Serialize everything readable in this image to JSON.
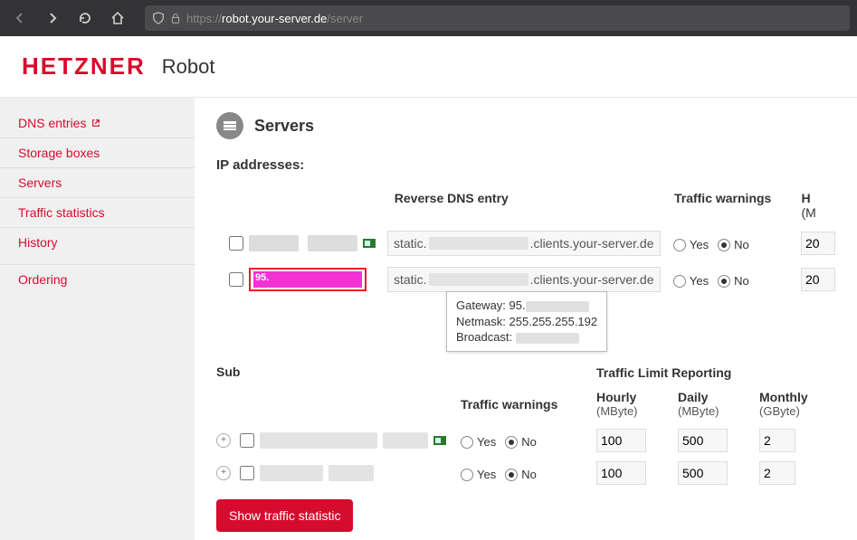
{
  "browser": {
    "url_prefix": "https://",
    "url_host": "robot.your-server.de",
    "url_path": "/server"
  },
  "header": {
    "logo": "HETZNER",
    "product": "Robot"
  },
  "sidebar": {
    "items": [
      "DNS entries",
      "Storage boxes",
      "Servers",
      "Traffic statistics",
      "History"
    ],
    "ordering": "Ordering"
  },
  "page": {
    "title": "Servers"
  },
  "ip": {
    "section": "IP addresses:",
    "rdns_hdr": "Reverse DNS entry",
    "warn_hdr": "Traffic warnings",
    "h_hdr": "H",
    "h_sub": "(M",
    "rows": [
      {
        "rdns_pre": "static.",
        "rdns_suf": ".clients.your-server.de",
        "yes": "Yes",
        "no": "No",
        "warn": "no",
        "h": "20"
      },
      {
        "ip_label": "95.",
        "rdns_pre": "static.",
        "rdns_suf": ".clients.your-server.de",
        "yes": "Yes",
        "no": "No",
        "warn": "no",
        "h": "20"
      }
    ]
  },
  "tooltip": {
    "line1_k": "Gateway:",
    "line1_v": "95.",
    "line2_k": "Netmask:",
    "line2_v": "255.255.255.192",
    "line3_k": "Broadcast:"
  },
  "subnets": {
    "section": "Subnets:",
    "warn_hdr": "Traffic warnings",
    "limit_hdr": "Traffic Limit Reporting",
    "hourly": "Hourly",
    "hourly_u": "(MByte)",
    "daily": "Daily",
    "daily_u": "(MByte)",
    "monthly": "Monthly",
    "monthly_u": "(GByte)",
    "rows": [
      {
        "yes": "Yes",
        "no": "No",
        "warn": "no",
        "hourly": "100",
        "daily": "500",
        "monthly": "2"
      },
      {
        "yes": "Yes",
        "no": "No",
        "warn": "no",
        "hourly": "100",
        "daily": "500",
        "monthly": "2"
      }
    ]
  },
  "button": {
    "show_stats": "Show traffic statistic"
  }
}
